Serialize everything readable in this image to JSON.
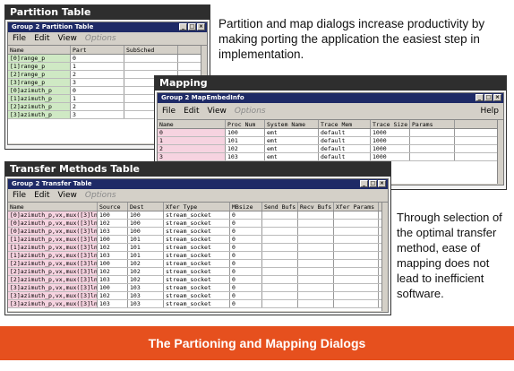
{
  "partition_panel": {
    "header": "Partition Table",
    "window_title": "Group 2 Partition Table",
    "menu": [
      "File",
      "Edit",
      "View"
    ],
    "menu_disabled": "Options",
    "columns": [
      "Name",
      "Part",
      "SubSched"
    ],
    "rows": [
      [
        "[0]range_p",
        "0",
        ""
      ],
      [
        "[1]range_p",
        "1",
        ""
      ],
      [
        "[2]range_p",
        "2",
        ""
      ],
      [
        "[3]range_p",
        "3",
        ""
      ],
      [
        "[0]azimuth_p",
        "0",
        ""
      ],
      [
        "[1]azimuth_p",
        "1",
        ""
      ],
      [
        "[2]azimuth_p",
        "2",
        ""
      ],
      [
        "[3]azimuth_p",
        "3",
        ""
      ]
    ]
  },
  "mapping_panel": {
    "header": "Mapping",
    "window_title": "Group 2 MapEmbedInfo",
    "menu": [
      "File",
      "Edit",
      "View"
    ],
    "menu_disabled": "Options",
    "help": "Help",
    "columns": [
      "Name",
      "Proc Num",
      "System Name",
      "Trace Mem",
      "Trace Size",
      "Params"
    ],
    "rows": [
      [
        "0",
        "100",
        "emt",
        "default",
        "1000",
        ""
      ],
      [
        "1",
        "101",
        "emt",
        "default",
        "1000",
        ""
      ],
      [
        "2",
        "102",
        "emt",
        "default",
        "1000",
        ""
      ],
      [
        "3",
        "103",
        "emt",
        "default",
        "1000",
        ""
      ]
    ]
  },
  "transfer_panel": {
    "header": "Transfer Methods Table",
    "window_title": "Group 2 Transfer Table",
    "menu": [
      "File",
      "Edit",
      "View"
    ],
    "menu_disabled": "Options",
    "columns": [
      "Name",
      "Source",
      "Dest",
      "Xfer Type",
      "MBsize",
      "Send Bufs",
      "Recv Bufs",
      "Xfer Params"
    ],
    "rows": [
      [
        "[0]azimuth_p,vx,mux([3]ln",
        "100",
        "100",
        "stream_socket",
        "0"
      ],
      [
        "[0]azimuth_p,vx,mux([3]ln",
        "102",
        "100",
        "stream_socket",
        "0"
      ],
      [
        "[0]azimuth_p,vx,mux([3]ln",
        "103",
        "100",
        "stream_socket",
        "0"
      ],
      [
        "[1]azimuth_p,vx,mux([3]ln",
        "100",
        "101",
        "stream_socket",
        "0"
      ],
      [
        "[1]azimuth_p,vx,mux([3]ln",
        "102",
        "101",
        "stream_socket",
        "0"
      ],
      [
        "[1]azimuth_p,vx,mux([3]ln",
        "103",
        "101",
        "stream_socket",
        "0"
      ],
      [
        "[2]azimuth_p,vx,mux([3]ln",
        "100",
        "102",
        "stream_socket",
        "0"
      ],
      [
        "[2]azimuth_p,vx,mux([3]ln",
        "102",
        "102",
        "stream_socket",
        "0"
      ],
      [
        "[2]azimuth_p,vx,mux([3]ln",
        "103",
        "102",
        "stream_socket",
        "0"
      ],
      [
        "[3]azimuth_p,vx,mux([3]ln",
        "100",
        "103",
        "stream_socket",
        "0"
      ],
      [
        "[3]azimuth_p,vx,mux([3]ln",
        "102",
        "103",
        "stream_socket",
        "0"
      ],
      [
        "[3]azimuth_p,vx,mux([3]ln",
        "103",
        "103",
        "stream_socket",
        "0"
      ]
    ]
  },
  "caption_top": "Partition and map dialogs increase productivity by making porting the application the easiest step in implementation.",
  "caption_right": "Through selection of the optimal transfer method, ease of mapping does not lead to inefficient software.",
  "banner": "The Partioning and Mapping Dialogs",
  "colors": {
    "banner": "#e6501e",
    "panel_header": "#2e2e2e",
    "window_title": "#1e2a66",
    "row_green": "#cfe9c4",
    "row_pink": "#f6d3e0"
  }
}
